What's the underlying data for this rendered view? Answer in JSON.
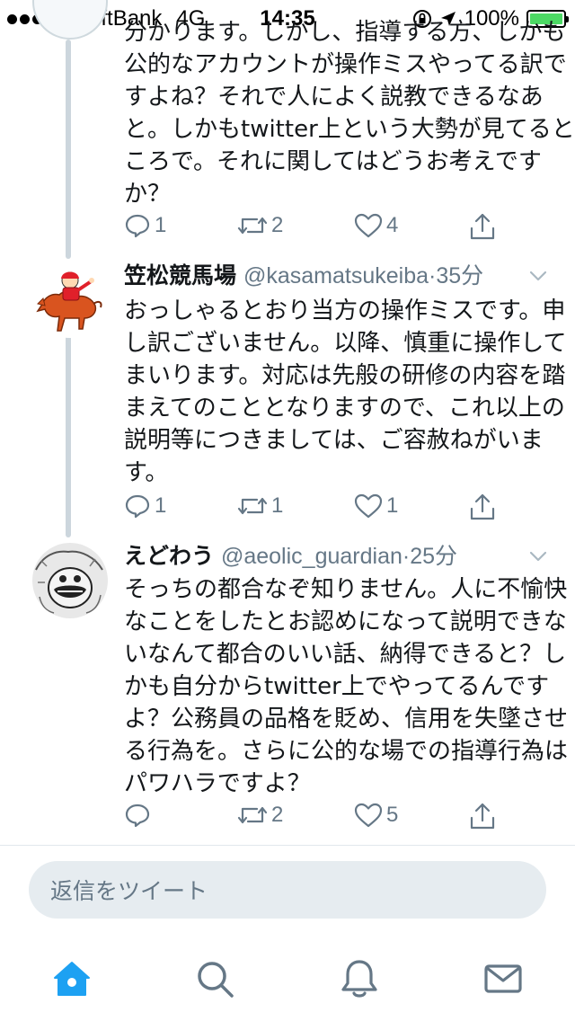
{
  "status_bar": {
    "carrier": "SoftBank",
    "network": "4G",
    "time": "14:35",
    "battery": "100%",
    "battery_level": 1.0
  },
  "tweets": [
    {
      "text": "分かります。しかし、指導する方、しかも\n公的なアカウントが操作ミスやってる訳で\nすよね？それで人によく説教できるなあ\nと。しかもtwitter上という大勢が見てると\nころで。それに関してはどうお考えです\nか？",
      "reply_count": "1",
      "retweet_count": "2",
      "like_count": "4"
    },
    {
      "name": "笠松競馬場",
      "handle": "@kasamatsukeiba",
      "time": "35分",
      "avatar": "horse-jockey-mascot",
      "text": "おっしゃるとおり当方の操作ミスです。申\nし訳ございません。以降、慎重に操作して\nまいります。対応は先般の研修の内容を踏\nまえてのこととなりますので、これ以上の\n説明等につきましては、ご容赦ねがいま\nす。",
      "reply_count": "1",
      "retweet_count": "1",
      "like_count": "1"
    },
    {
      "name": "えどわう",
      "handle": "@aeolic_guardian",
      "time": "25分",
      "avatar": "manga-sketch-avatar",
      "text": "そっちの都合なぞ知りません。人に不愉快\nなことをしたとお認めになって説明できな\nいなんて都合のいい話、納得できると？し\nかも自分からtwitter上でやってるんです\nよ？公務員の品格を貶め、信用を失墜させ\nる行為を。さらに公的な場での指導行為は\nパワハラですよ？",
      "reply_count": "",
      "retweet_count": "2",
      "like_count": "5"
    }
  ],
  "reply_box": {
    "placeholder": "返信をツイート"
  },
  "tabbar": {
    "items": [
      "home-icon",
      "search-icon",
      "notifications-icon",
      "messages-icon"
    ],
    "active": "home-icon"
  },
  "colors": {
    "accent": "#1da1f2",
    "muted": "#657786",
    "thread": "#ccd6dd"
  }
}
